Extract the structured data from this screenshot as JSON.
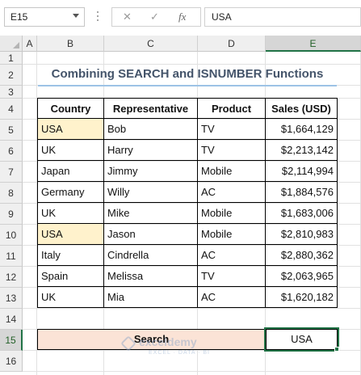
{
  "formula_bar": {
    "name_box": "E15",
    "cancel_icon": "✕",
    "enter_icon": "✓",
    "fx_label": "fx",
    "formula": "USA"
  },
  "columns": [
    "A",
    "B",
    "C",
    "D",
    "E"
  ],
  "rows": [
    "1",
    "2",
    "3",
    "4",
    "5",
    "6",
    "7",
    "8",
    "9",
    "10",
    "11",
    "12",
    "13",
    "14",
    "15",
    "16"
  ],
  "title": "Combining SEARCH and ISNUMBER Functions",
  "table": {
    "headers": [
      "Country",
      "Representative",
      "Product",
      "Sales (USD)"
    ],
    "rows": [
      [
        "USA",
        "Bob",
        "TV",
        "$1,664,129"
      ],
      [
        "UK",
        "Harry",
        "TV",
        "$2,213,142"
      ],
      [
        "Japan",
        "Jimmy",
        "Mobile",
        "$2,114,994"
      ],
      [
        "Germany",
        "Willy",
        "AC",
        "$1,884,576"
      ],
      [
        "UK",
        "Mike",
        "Mobile",
        "$1,683,006"
      ],
      [
        "USA",
        "Jason",
        "Mobile",
        "$2,810,983"
      ],
      [
        "Italy",
        "Cindrella",
        "AC",
        "$2,880,362"
      ],
      [
        "Spain",
        "Melissa",
        "TV",
        "$2,063,965"
      ],
      [
        "UK",
        "Mia",
        "AC",
        "$1,620,182"
      ]
    ],
    "highlighted_rows": [
      0,
      5
    ]
  },
  "search": {
    "label": "Search",
    "value": "USA"
  },
  "watermark": {
    "name": "exceldemy",
    "tagline": "EXCEL · DATA · BI"
  },
  "colors": {
    "accent": "#217346",
    "highlight": "#fff2cc",
    "search_fill": "#fbe3d6",
    "title_color": "#44546a",
    "title_underline": "#9dc3e6"
  }
}
